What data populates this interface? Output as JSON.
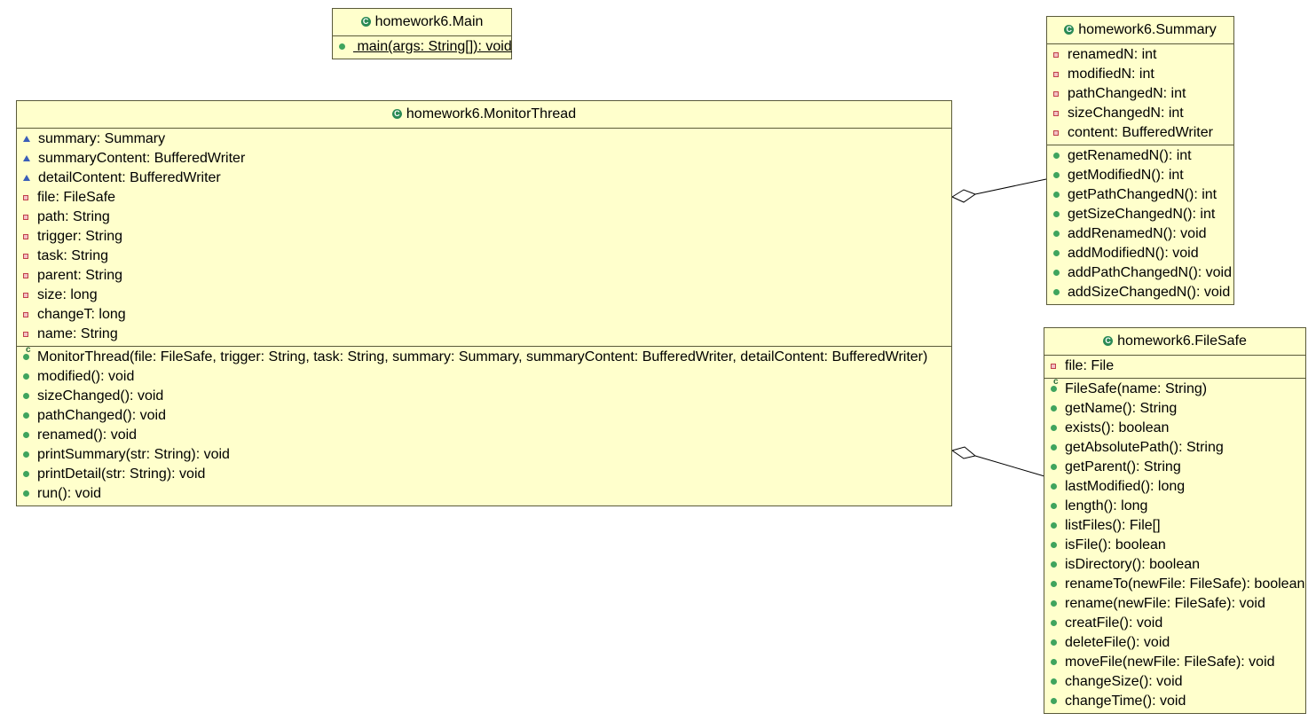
{
  "classes": {
    "main": {
      "title": "homework6.Main",
      "methods": [
        {
          "text": " main(args: String[]): void",
          "vis": "public",
          "static": true
        }
      ]
    },
    "monitor": {
      "title": "homework6.MonitorThread",
      "fields": [
        {
          "text": "summary: Summary",
          "vis": "package"
        },
        {
          "text": "summaryContent: BufferedWriter",
          "vis": "package"
        },
        {
          "text": "detailContent: BufferedWriter",
          "vis": "package"
        },
        {
          "text": "file: FileSafe",
          "vis": "private"
        },
        {
          "text": "path: String",
          "vis": "private"
        },
        {
          "text": "trigger: String",
          "vis": "private"
        },
        {
          "text": "task: String",
          "vis": "private"
        },
        {
          "text": "parent: String",
          "vis": "private"
        },
        {
          "text": "size: long",
          "vis": "private"
        },
        {
          "text": "changeT: long",
          "vis": "private"
        },
        {
          "text": "name: String",
          "vis": "private"
        }
      ],
      "methods": [
        {
          "text": "MonitorThread(file: FileSafe, trigger: String, task: String, summary: Summary, summaryContent: BufferedWriter, detailContent: BufferedWriter)",
          "vis": "ctor"
        },
        {
          "text": "modified(): void",
          "vis": "public"
        },
        {
          "text": "sizeChanged(): void",
          "vis": "public"
        },
        {
          "text": "pathChanged(): void",
          "vis": "public"
        },
        {
          "text": "renamed(): void",
          "vis": "public"
        },
        {
          "text": "printSummary(str: String): void",
          "vis": "public"
        },
        {
          "text": "printDetail(str: String): void",
          "vis": "public"
        },
        {
          "text": "run(): void",
          "vis": "public"
        }
      ]
    },
    "summary": {
      "title": "homework6.Summary",
      "fields": [
        {
          "text": "renamedN: int",
          "vis": "private"
        },
        {
          "text": "modifiedN: int",
          "vis": "private"
        },
        {
          "text": "pathChangedN: int",
          "vis": "private"
        },
        {
          "text": "sizeChangedN: int",
          "vis": "private"
        },
        {
          "text": "content: BufferedWriter",
          "vis": "private"
        }
      ],
      "methods": [
        {
          "text": "getRenamedN(): int",
          "vis": "public"
        },
        {
          "text": "getModifiedN(): int",
          "vis": "public"
        },
        {
          "text": "getPathChangedN(): int",
          "vis": "public"
        },
        {
          "text": "getSizeChangedN(): int",
          "vis": "public"
        },
        {
          "text": "addRenamedN(): void",
          "vis": "public"
        },
        {
          "text": "addModifiedN(): void",
          "vis": "public"
        },
        {
          "text": "addPathChangedN(): void",
          "vis": "public"
        },
        {
          "text": "addSizeChangedN(): void",
          "vis": "public"
        }
      ]
    },
    "filesafe": {
      "title": "homework6.FileSafe",
      "fields": [
        {
          "text": "file: File",
          "vis": "private"
        }
      ],
      "methods": [
        {
          "text": "FileSafe(name: String)",
          "vis": "ctor"
        },
        {
          "text": "getName(): String",
          "vis": "public"
        },
        {
          "text": "exists(): boolean",
          "vis": "public"
        },
        {
          "text": "getAbsolutePath(): String",
          "vis": "public"
        },
        {
          "text": "getParent(): String",
          "vis": "public"
        },
        {
          "text": "lastModified(): long",
          "vis": "public"
        },
        {
          "text": "length(): long",
          "vis": "public"
        },
        {
          "text": "listFiles(): File[]",
          "vis": "public"
        },
        {
          "text": "isFile(): boolean",
          "vis": "public"
        },
        {
          "text": "isDirectory(): boolean",
          "vis": "public"
        },
        {
          "text": "renameTo(newFile: FileSafe): boolean",
          "vis": "public"
        },
        {
          "text": "rename(newFile: FileSafe): void",
          "vis": "public"
        },
        {
          "text": "creatFile(): void",
          "vis": "public"
        },
        {
          "text": "deleteFile(): void",
          "vis": "public"
        },
        {
          "text": "moveFile(newFile: FileSafe): void",
          "vis": "public"
        },
        {
          "text": "changeSize(): void",
          "vis": "public"
        },
        {
          "text": "changeTime(): void",
          "vis": "public"
        }
      ]
    }
  },
  "colors": {
    "class_fill": "#ffffcc",
    "class_border": "#5a5a3a",
    "class_icon": "#2a8a55",
    "public_icon": "#3fa45e",
    "private_icon": "#c0404a",
    "package_icon": "#3a5eb8"
  },
  "icons": {
    "class": "class-icon",
    "public": "public-method-icon",
    "private": "private-field-icon",
    "package": "package-field-icon",
    "ctor": "constructor-icon"
  }
}
